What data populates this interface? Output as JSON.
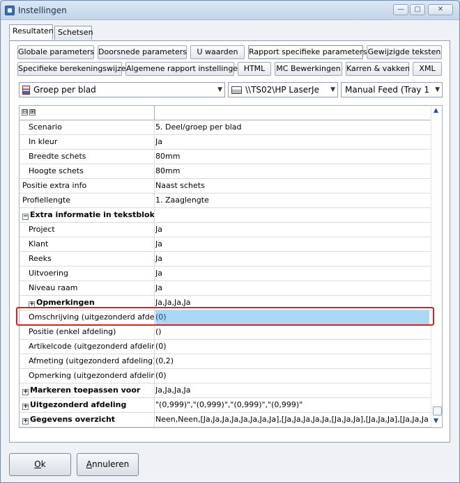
{
  "window": {
    "title": "Instellingen"
  },
  "titlebar_buttons": {
    "minimize": "—",
    "maximize": "▢",
    "close": "✕"
  },
  "top_tabs": [
    "Resultaten",
    "Schetsen"
  ],
  "param_tabs_row1": [
    "Globale parameters",
    "Doorsnede parameters",
    "U waarden",
    "Rapport specifieke parameters",
    "Gewijzigde teksten"
  ],
  "param_tabs_row2": [
    "Specifieke berekeningswijzen",
    "Algemene rapport instellingen",
    "HTML",
    "MC Bewerkingen",
    "Karren & vakken",
    "XML"
  ],
  "active_param_tab": "Rapport specifieke parameters",
  "combos": {
    "report_type": "Groep per blad",
    "printer": "\\\\TS02\\HP LaserJe",
    "feed": "Manual Feed (Tray 1"
  },
  "grid": {
    "header_expand": "⊟",
    "header_collapse": "⊞",
    "rows": [
      {
        "key": "Scenario",
        "value": "5. Deel/groep per blad",
        "indent": 1
      },
      {
        "key": "In kleur",
        "value": "Ja",
        "indent": 1
      },
      {
        "key": "Breedte schets",
        "value": "80mm",
        "indent": 1
      },
      {
        "key": "Hoogte schets",
        "value": "80mm",
        "indent": 1
      },
      {
        "key": "Positie extra info",
        "value": "Naast schets",
        "indent": 0
      },
      {
        "key": "Profiellengte",
        "value": "1. Zaaglengte",
        "indent": 0
      },
      {
        "key": "Extra informatie in tekstblok",
        "value": "",
        "indent": 0,
        "bold": true,
        "expander": "−"
      },
      {
        "key": "Project",
        "value": "Ja",
        "indent": 1
      },
      {
        "key": "Klant",
        "value": "Ja",
        "indent": 1
      },
      {
        "key": "Reeks",
        "value": "Ja",
        "indent": 1
      },
      {
        "key": "Uitvoering",
        "value": "Ja",
        "indent": 1
      },
      {
        "key": "Niveau raam",
        "value": "Ja",
        "indent": 1
      },
      {
        "key": "Opmerkingen",
        "value": "Ja,Ja,Ja,Ja",
        "indent": 1,
        "bold": true,
        "expander": "+"
      },
      {
        "key": "Omschrijving (uitgezonderd afdeling)",
        "value": "(0)",
        "indent": 1,
        "selected": true
      },
      {
        "key": "Positie (enkel afdeling)",
        "value": "()",
        "indent": 1
      },
      {
        "key": "Artikelcode (uitgezonderd afdeling)",
        "value": "(0)",
        "indent": 1
      },
      {
        "key": "Afmeting (uitgezonderd afdeling)",
        "value": "(0,2)",
        "indent": 1
      },
      {
        "key": "Opmerking (uitgezonderd afdeling)",
        "value": "(0)",
        "indent": 1
      },
      {
        "key": "Markeren toepassen voor",
        "value": "Ja,Ja,Ja,Ja",
        "indent": 0,
        "bold": true,
        "expander": "+"
      },
      {
        "key": "Uitgezonderd afdeling",
        "value": "\"(0,999)\",\"(0,999)\",\"(0,999)\",\"(0,999)\"",
        "indent": 0,
        "bold": true,
        "expander": "+"
      },
      {
        "key": "Gegevens overzicht",
        "value": "Neen,Neen,[Ja,Ja,Ja,Ja,Ja,Ja,Ja,Ja],[Ja,Ja,Ja,Ja,Ja,[Ja,Ja,Ja],[Ja,Ja,Ja],[Ja,Ja,Ja],",
        "indent": 0,
        "bold": true,
        "expander": "+"
      }
    ]
  },
  "scroll": {
    "up": "▲",
    "down": "▼"
  },
  "buttons": {
    "ok_underline": "O",
    "ok_rest": "k",
    "cancel_underline": "A",
    "cancel_rest": "nnuleren"
  }
}
